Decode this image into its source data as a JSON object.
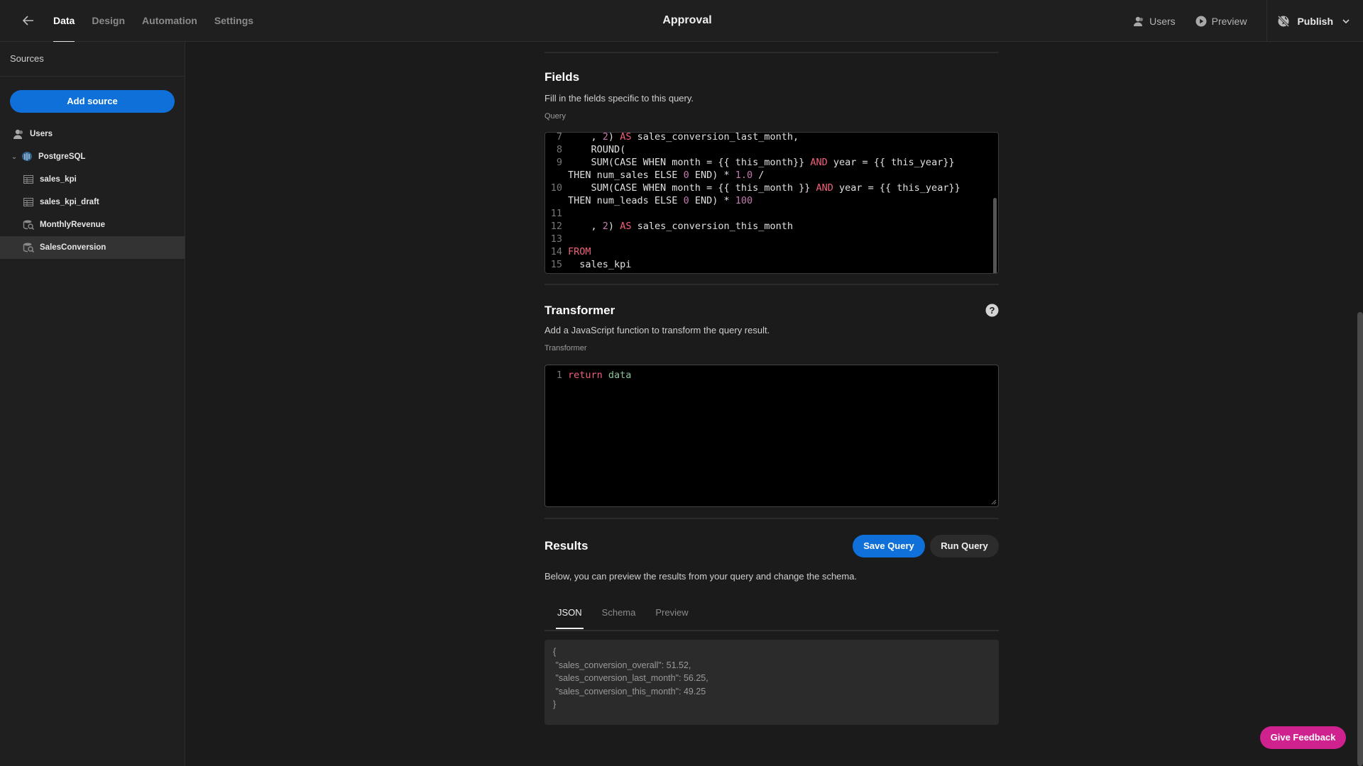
{
  "topbar": {
    "back_icon": "arrow-left-icon",
    "nav_tabs": [
      {
        "label": "Data",
        "active": true
      },
      {
        "label": "Design",
        "active": false
      },
      {
        "label": "Automation",
        "active": false
      },
      {
        "label": "Settings",
        "active": false
      }
    ],
    "app_title": "Approval",
    "users_label": "Users",
    "preview_label": "Preview",
    "publish_label": "Publish"
  },
  "sidebar": {
    "header": "Sources",
    "add_source_label": "Add source",
    "items": [
      {
        "label": "Users",
        "icon": "users-icon",
        "level": 0
      },
      {
        "label": "PostgreSQL",
        "icon": "postgresql-icon",
        "level": 0,
        "expanded": true
      },
      {
        "label": "sales_kpi",
        "icon": "table-icon",
        "level": 1
      },
      {
        "label": "sales_kpi_draft",
        "icon": "table-icon",
        "level": 1
      },
      {
        "label": "MonthlyRevenue",
        "icon": "query-icon",
        "level": 1
      },
      {
        "label": "SalesConversion",
        "icon": "query-icon",
        "level": 1,
        "active": true
      }
    ]
  },
  "fields": {
    "title": "Fields",
    "description": "Fill in the fields specific to this query.",
    "query_label": "Query",
    "query_lines": [
      {
        "n": "7",
        "segments": [
          [
            "",
            "    , "
          ],
          [
            "num",
            "2"
          ],
          [
            "",
            ") "
          ],
          [
            "kw",
            "AS"
          ],
          [
            "",
            " sales_conversion_last_month,"
          ]
        ]
      },
      {
        "n": "8",
        "segments": [
          [
            "",
            "    ROUND("
          ]
        ]
      },
      {
        "n": "9",
        "segments": [
          [
            "",
            "    SUM(CASE WHEN month = {{ this_month}} "
          ],
          [
            "kw",
            "AND"
          ],
          [
            "",
            " year = {{ this_year}}"
          ]
        ]
      },
      {
        "n": "",
        "segments": [
          [
            "",
            "THEN num_sales ELSE "
          ],
          [
            "num",
            "0"
          ],
          [
            "",
            " END) * "
          ],
          [
            "num",
            "1.0"
          ],
          [
            "",
            " /"
          ]
        ]
      },
      {
        "n": "10",
        "segments": [
          [
            "",
            "    SUM(CASE WHEN month = {{ this_month }} "
          ],
          [
            "kw",
            "AND"
          ],
          [
            "",
            " year = {{ this_year}}"
          ]
        ]
      },
      {
        "n": "",
        "segments": [
          [
            "",
            "THEN num_leads ELSE "
          ],
          [
            "num",
            "0"
          ],
          [
            "",
            " END) * "
          ],
          [
            "num",
            "100"
          ]
        ]
      },
      {
        "n": "11",
        "segments": [
          [
            "",
            ""
          ]
        ]
      },
      {
        "n": "12",
        "segments": [
          [
            "",
            "    , "
          ],
          [
            "num",
            "2"
          ],
          [
            "",
            ") "
          ],
          [
            "kw",
            "AS"
          ],
          [
            "",
            " sales_conversion_this_month"
          ]
        ]
      },
      {
        "n": "13",
        "segments": [
          [
            "",
            ""
          ]
        ]
      },
      {
        "n": "14",
        "segments": [
          [
            "kw",
            "FROM"
          ]
        ]
      },
      {
        "n": "15",
        "segments": [
          [
            "",
            "  sales_kpi"
          ]
        ]
      }
    ]
  },
  "transformer": {
    "title": "Transformer",
    "description": "Add a JavaScript function to transform the query result.",
    "label": "Transformer",
    "help_icon": "help-circle-icon",
    "line_number": "1",
    "code_keyword": "return",
    "code_value": "data"
  },
  "results": {
    "title": "Results",
    "save_label": "Save Query",
    "run_label": "Run Query",
    "description": "Below, you can preview the results from your query and change the schema.",
    "tabs": [
      {
        "label": "JSON",
        "active": true
      },
      {
        "label": "Schema",
        "active": false
      },
      {
        "label": "Preview",
        "active": false
      }
    ],
    "json_output": "{\n \"sales_conversion_overall\": 51.52,\n \"sales_conversion_last_month\": 56.25,\n \"sales_conversion_this_month\": 49.25\n}"
  },
  "feedback_label": "Give Feedback",
  "colors": {
    "accent": "#0f70d9",
    "feedback": "#d0228f",
    "keyword": "#f0607a",
    "number": "#c47ab0",
    "identifier": "#8cc09a"
  }
}
